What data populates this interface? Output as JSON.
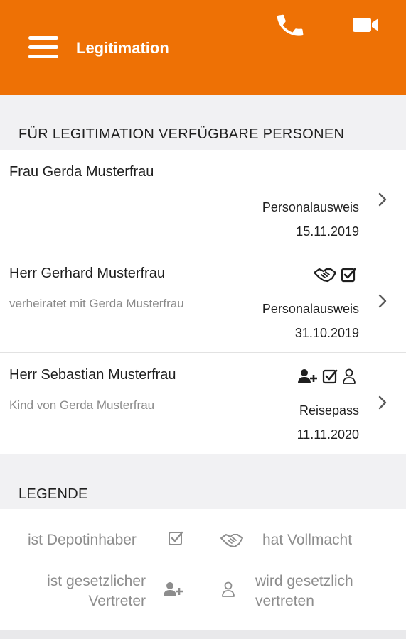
{
  "header": {
    "title": "Legitimation",
    "background_color": "#ee7105",
    "icons": [
      "menu-icon",
      "phone-icon",
      "video-camera-icon"
    ]
  },
  "persons_section": {
    "title": "FÜR LEGITIMATION VERFÜGBARE PERSONEN",
    "rows": [
      {
        "name": "Frau Gerda Musterfrau",
        "relation": "",
        "document": "Personalausweis",
        "date": "15.11.2019",
        "icons": []
      },
      {
        "name": "Herr Gerhard Musterfrau",
        "relation": "verheiratet mit Gerda Musterfrau",
        "document": "Personalausweis",
        "date": "31.10.2019",
        "icons": [
          "handshake-icon",
          "checkbox-checked-icon"
        ]
      },
      {
        "name": "Herr Sebastian Musterfrau",
        "relation": "Kind von Gerda Musterfrau",
        "document": "Reisepass",
        "date": "11.11.2020",
        "icons": [
          "user-plus-icon",
          "checkbox-checked-icon",
          "user-outline-icon"
        ]
      }
    ]
  },
  "legend": {
    "title": "LEGENDE",
    "depot_owner": "ist Depotinhaber",
    "legal_rep_line1": "ist gesetzlicher",
    "legal_rep_line2": "Vertreter",
    "power_of_attorney": "hat Vollmacht",
    "represented_line1": "wird gesetzlich",
    "represented_line2": "vertreten"
  }
}
